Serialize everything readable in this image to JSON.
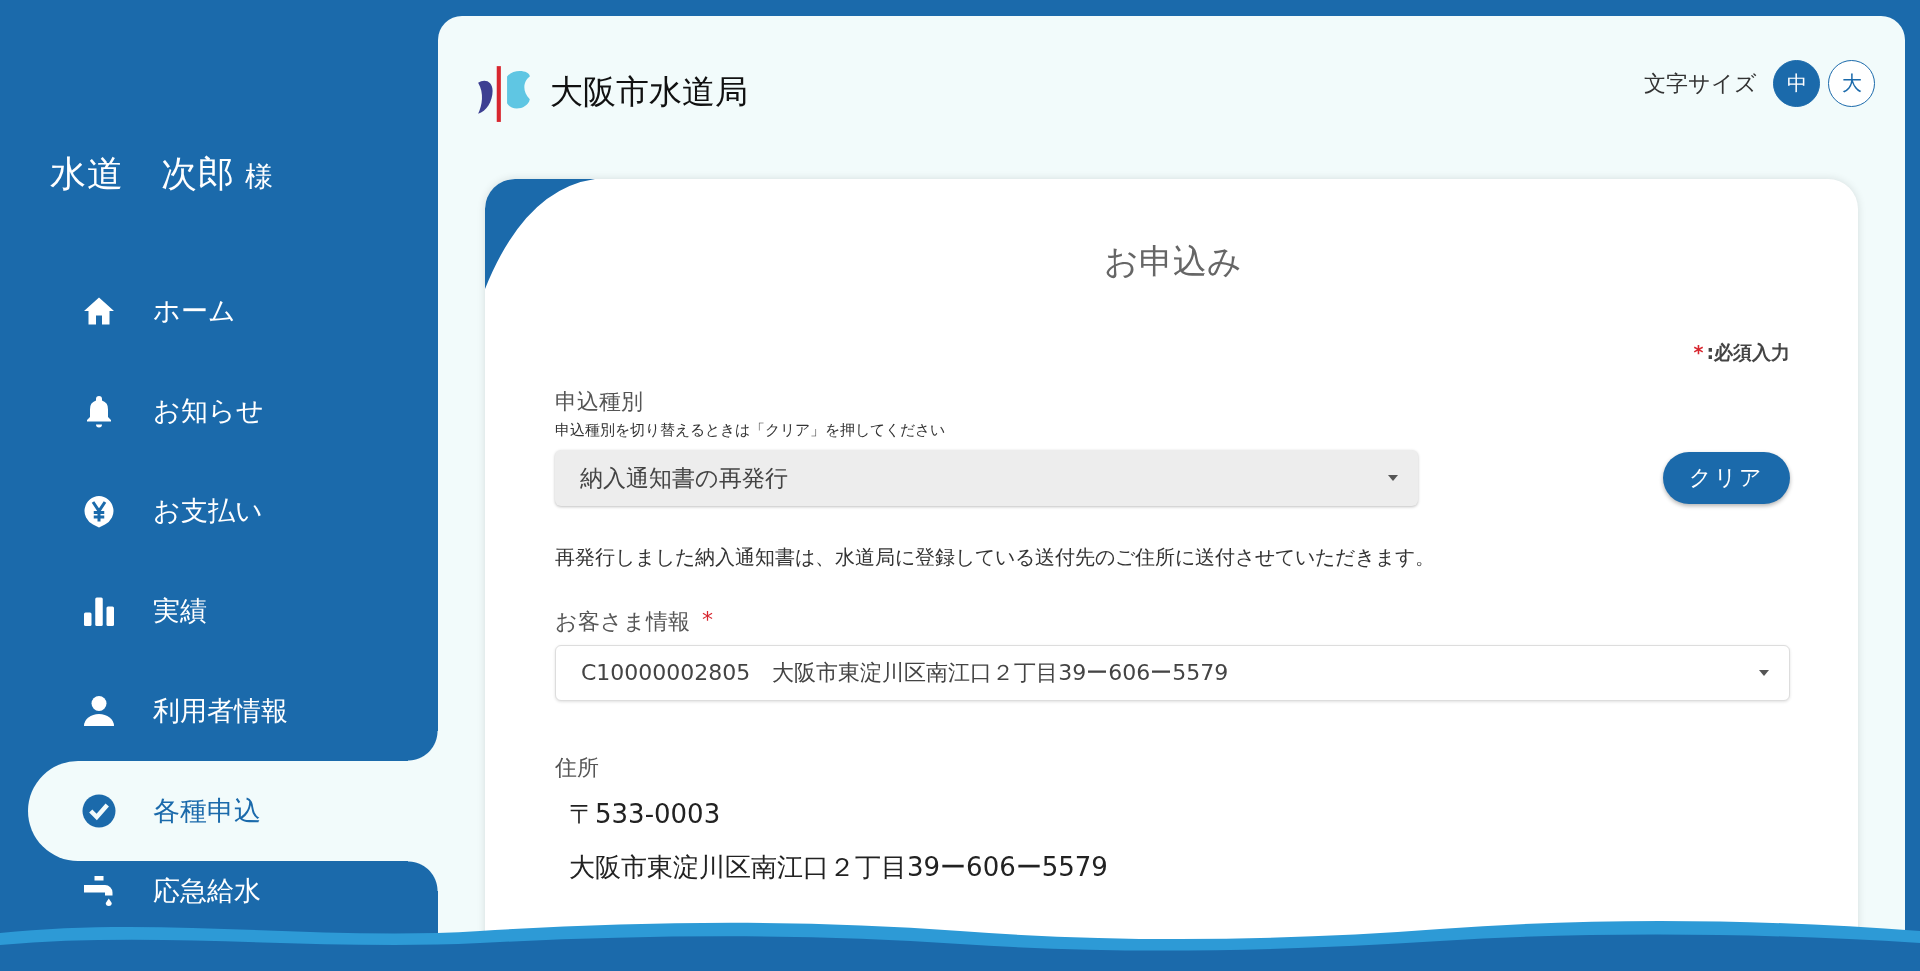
{
  "user": {
    "name": "水道　次郎",
    "honorific": "様"
  },
  "nav": [
    {
      "label": "ホーム",
      "kind": "home",
      "selected": false
    },
    {
      "label": "お知らせ",
      "kind": "bell",
      "selected": false
    },
    {
      "label": "お支払い",
      "kind": "yen",
      "selected": false
    },
    {
      "label": "実績",
      "kind": "chart",
      "selected": false
    },
    {
      "label": "利用者情報",
      "kind": "user",
      "selected": false
    },
    {
      "label": "各種申込",
      "kind": "check",
      "selected": true
    },
    {
      "label": "応急給水",
      "kind": "faucet",
      "selected": false
    }
  ],
  "logo": {
    "text": "大阪市水道局"
  },
  "font_size": {
    "label": "文字サイズ",
    "options": [
      {
        "label": "中",
        "selected": true
      },
      {
        "label": "大",
        "selected": false
      }
    ]
  },
  "form": {
    "title": "お申込み",
    "required_note": {
      "mark": "*",
      "text": ":必須入力"
    },
    "application_type": {
      "label": "申込種別",
      "hint": "申込種別を切り替えるときは「クリア」を押してください",
      "value": "納入通知書の再発行"
    },
    "clear_button": "クリア",
    "notice": "再発行しました納入通知書は、水道局に登録している送付先のご住所に送付させていただきます。",
    "customer": {
      "label": "お客さま情報",
      "required_mark": "*",
      "value": "C10000002805　大阪市東淀川区南江口２丁目39ー606ー5579"
    },
    "address": {
      "label": "住所",
      "postal": "〒533-0003",
      "line": "大阪市東淀川区南江口２丁目39ー606ー5579"
    }
  }
}
